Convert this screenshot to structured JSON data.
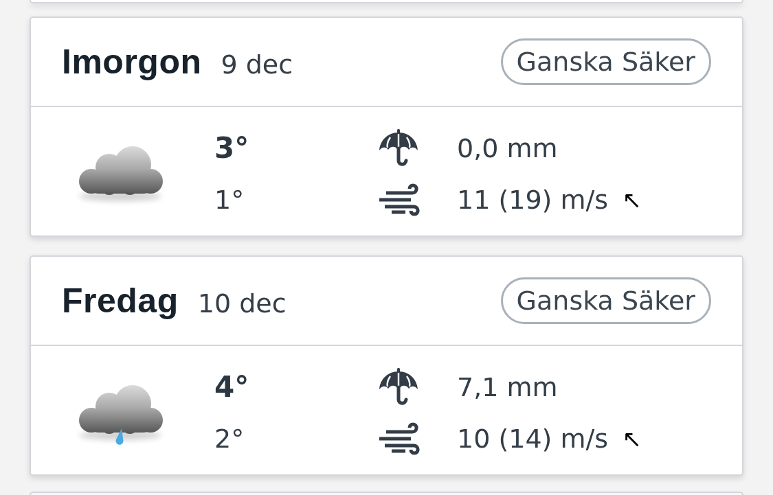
{
  "days": [
    {
      "day": "Imorgon",
      "date": "9 dec",
      "confidence": "Ganska Säker",
      "kind": "cloudy",
      "high": "3°",
      "low": "1°",
      "precipitation": "0,0 mm",
      "wind": "11 (19) m/s",
      "wind_direction": "↖"
    },
    {
      "day": "Fredag",
      "date": "10 dec",
      "confidence": "Ganska Säker",
      "kind": "rain",
      "high": "4°",
      "low": "2°",
      "precipitation": "7,1 mm",
      "wind": "10 (14) m/s",
      "wind_direction": "↖"
    }
  ]
}
